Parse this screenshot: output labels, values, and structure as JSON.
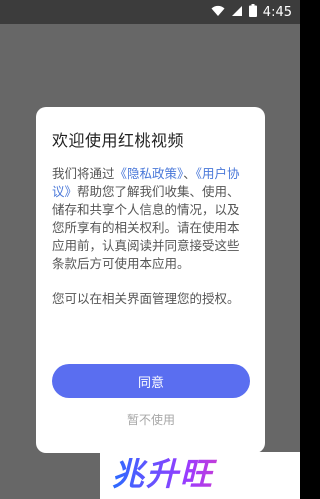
{
  "status_bar": {
    "time": "4:45",
    "icons": [
      "wifi-icon",
      "signal-icon",
      "battery-icon"
    ]
  },
  "dialog": {
    "title": "欢迎使用红桃视频",
    "paragraph1": {
      "prefix": "我们将通过",
      "link1": "《隐私政策》",
      "separator": "、",
      "link2": "《用户协议》",
      "rest": "帮助您了解我们收集、使用、储存和共享个人信息的情况，以及您所享有的相关权利。请在使用本应用前，认真阅读并同意接受这些条款后方可使用本应用。"
    },
    "paragraph2": "您可以在相关界面管理您的授权。",
    "agree_label": "同意",
    "decline_label": "暂不使用"
  },
  "watermark": {
    "text": "兆升旺"
  },
  "colors": {
    "accent": "#5a6ef0",
    "link": "#4a78d9",
    "overlay": "#676767"
  }
}
